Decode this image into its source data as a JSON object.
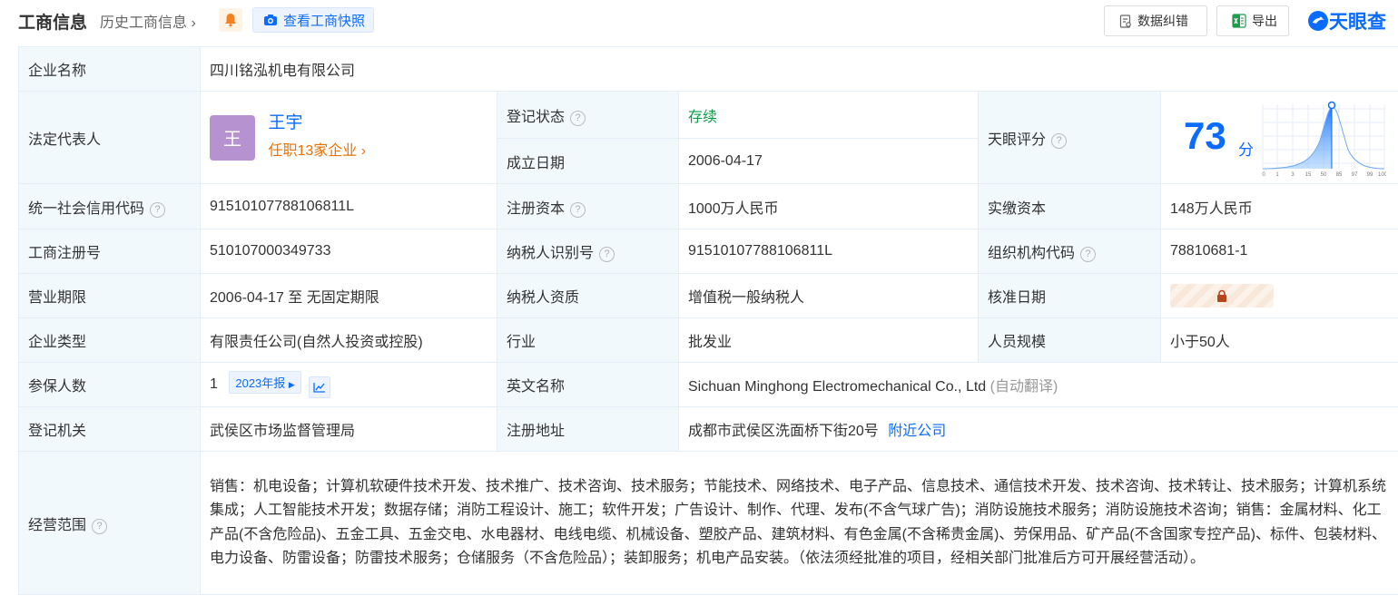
{
  "header": {
    "title": "工商信息",
    "history_link": "历史工商信息",
    "snapshot_btn": "查看工商快照",
    "correction_btn": "数据纠错",
    "export_btn": "导出",
    "logo_text": "天眼查"
  },
  "colors": {
    "accent": "#0a6cff",
    "status_green": "#0a9d48",
    "orange": "#f07000",
    "label_bg": "#f2f9fc"
  },
  "company": {
    "name_label": "企业名称",
    "name": "四川铭泓机电有限公司",
    "legal_rep_label": "法定代表人",
    "legal_rep_avatar": "王",
    "legal_rep_name": "王宇",
    "legal_rep_jobs": "任职13家企业",
    "status_label": "登记状态",
    "status": "存续",
    "founded_label": "成立日期",
    "founded": "2006-04-17",
    "score_label": "天眼评分",
    "score": "73",
    "score_unit": "分",
    "score_ticks": [
      "0",
      "1",
      "3",
      "15",
      "50",
      "85",
      "97",
      "99",
      "100"
    ],
    "credit_code_label": "统一社会信用代码",
    "credit_code": "91510107788106811L",
    "reg_capital_label": "注册资本",
    "reg_capital": "1000万人民币",
    "paid_capital_label": "实缴资本",
    "paid_capital": "148万人民币",
    "reg_no_label": "工商注册号",
    "reg_no": "510107000349733",
    "taxpayer_id_label": "纳税人识别号",
    "taxpayer_id": "91510107788106811L",
    "org_code_label": "组织机构代码",
    "org_code": "78810681-1",
    "term_label": "营业期限",
    "term": "2006-04-17 至 无固定期限",
    "taxpayer_qual_label": "纳税人资质",
    "taxpayer_qual": "增值税一般纳税人",
    "approval_date_label": "核准日期",
    "type_label": "企业类型",
    "type": "有限责任公司(自然人投资或控股)",
    "industry_label": "行业",
    "industry": "批发业",
    "staff_label": "人员规模",
    "staff": "小于50人",
    "insured_label": "参保人数",
    "insured": "1",
    "insured_report": "2023年报",
    "en_name_label": "英文名称",
    "en_name": "Sichuan Minghong Electromechanical Co., Ltd",
    "en_name_note": "(自动翻译)",
    "authority_label": "登记机关",
    "authority": "武侯区市场监督管理局",
    "address_label": "注册地址",
    "address": "成都市武侯区洗面桥下街20号",
    "nearby": "附近公司",
    "scope_label": "经营范围",
    "scope": "销售：机电设备；计算机软硬件技术开发、技术推广、技术咨询、技术服务；节能技术、网络技术、电子产品、信息技术、通信技术开发、技术咨询、技术转让、技术服务；计算机系统集成；人工智能技术开发；数据存储；消防工程设计、施工；软件开发；广告设计、制作、代理、发布(不含气球广告)；消防设施技术服务；消防设施技术咨询；销售：金属材料、化工产品(不含危险品)、五金工具、五金交电、水电器材、电线电缆、机械设备、塑胶产品、建筑材料、有色金属(不含稀贵金属)、劳保用品、矿产品(不含国家专控产品)、标件、包装材料、电力设备、防雷设备；防雷技术服务；仓储服务（不含危险品）；装卸服务；机电产品安装。（依法须经批准的项目，经相关部门批准后方可开展经营活动）。"
  }
}
